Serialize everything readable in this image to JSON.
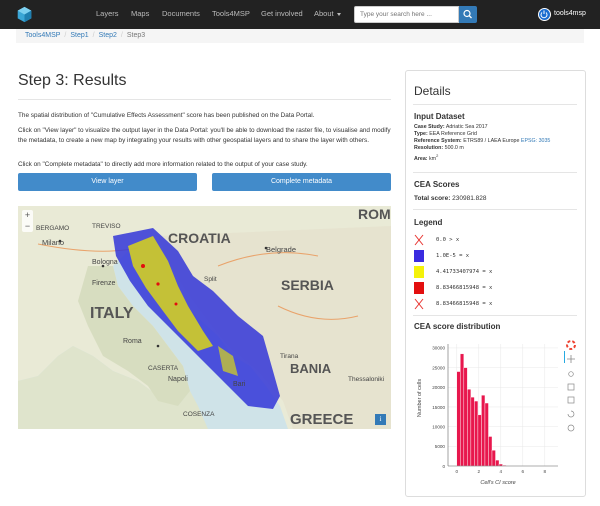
{
  "nav": {
    "items": [
      "Layers",
      "Maps",
      "Documents",
      "Tools4MSP",
      "Get involved",
      "About"
    ],
    "search_placeholder": "Type your search here ...",
    "user": "tools4msp"
  },
  "breadcrumb": [
    "Tools4MSP",
    "Step1",
    "Step2",
    "Step3"
  ],
  "main": {
    "title": "Step 3: Results",
    "p1": "The spatial distribution of \"Cumulative Effects Assessment\" score has been published on the Data Portal.",
    "p2": "Click on \"View layer\" to visualize the output layer in the Data Portal: you'll be able to download the raster file, to visualise and modify the metadata, to create a new map by integrating your results with other geospatial layers and to share the layer with others.",
    "p3": "Click on \"Complete metadata\" to directly add more information related to the output of your case study.",
    "view_layer": "View layer",
    "complete_metadata": "Complete metadata"
  },
  "map": {
    "zoom_in": "+",
    "zoom_out": "−",
    "info": "i",
    "labels": {
      "ROM": "ROM",
      "CROATIA": "CROATIA",
      "SERBIA": "SERBIA",
      "ITALY": "ITALY",
      "BANIA": "BANIA",
      "GREECE": "GREECE",
      "BERGAMO": "BERGAMO",
      "Milano": "Milano",
      "TREVISO": "TREVISO",
      "Belgrade": "Belgrade",
      "Bologna": "Bologna",
      "Firenze": "Firenze",
      "Roma": "Roma",
      "Napoli": "Napoli",
      "Bari": "Bari",
      "CASERTA": "CASERTA",
      "COSENZA": "COSENZA",
      "Thessaloniki": "Thessaloniki",
      "Tirana": "Tirana",
      "Split": "Split"
    }
  },
  "details": {
    "title": "Details",
    "input_heading": "Input Dataset",
    "case_study_label": "Case Study:",
    "case_study": "Adriatic Sea 2017",
    "type_label": "Type:",
    "type": "EEA Reference Grid",
    "ref_label": "Reference System:",
    "ref": "ETRS89 / LAEA Europe",
    "epsg": "EPSG: 3035",
    "res_label": "Resolution:",
    "res": "500.0 m",
    "area_label": "Area:",
    "area": "km",
    "cea_heading": "CEA Scores",
    "total_label": "Total score:",
    "total": "230981.828",
    "legend_heading": "Legend",
    "legend": [
      {
        "label": "0.0 > x",
        "color": "#e8322e"
      },
      {
        "label": "1.0E-5 = x",
        "color": "#3a2be0"
      },
      {
        "label": "4.41733407974 = x",
        "color": "#f4f20a"
      },
      {
        "label": "8.83466815948 = x",
        "color": "#e30f0f"
      },
      {
        "label": "8.83466815948 = x",
        "color": "#e8322e"
      }
    ],
    "dist_heading": "CEA score distribution"
  },
  "chart_data": {
    "type": "bar",
    "xlabel": "Cell's CI score",
    "ylabel": "Number of cells",
    "yticks": [
      0,
      5000,
      10000,
      15000,
      20000,
      25000,
      30000
    ],
    "xticks": [
      0,
      2,
      4,
      6,
      8
    ],
    "ylim": [
      0,
      31000
    ],
    "xlim": [
      -0.8,
      9.2
    ],
    "bin_width": 0.32,
    "bins": [
      {
        "x": 0.0,
        "y": 24000
      },
      {
        "x": 0.32,
        "y": 28500
      },
      {
        "x": 0.64,
        "y": 25000
      },
      {
        "x": 0.96,
        "y": 19500
      },
      {
        "x": 1.28,
        "y": 17500
      },
      {
        "x": 1.6,
        "y": 16500
      },
      {
        "x": 1.92,
        "y": 13000
      },
      {
        "x": 2.24,
        "y": 18000
      },
      {
        "x": 2.56,
        "y": 16000
      },
      {
        "x": 2.88,
        "y": 7500
      },
      {
        "x": 3.2,
        "y": 4000
      },
      {
        "x": 3.52,
        "y": 1500
      },
      {
        "x": 3.84,
        "y": 500
      },
      {
        "x": 4.16,
        "y": 200
      }
    ],
    "bar_color": "#e8174d",
    "grid": true
  }
}
